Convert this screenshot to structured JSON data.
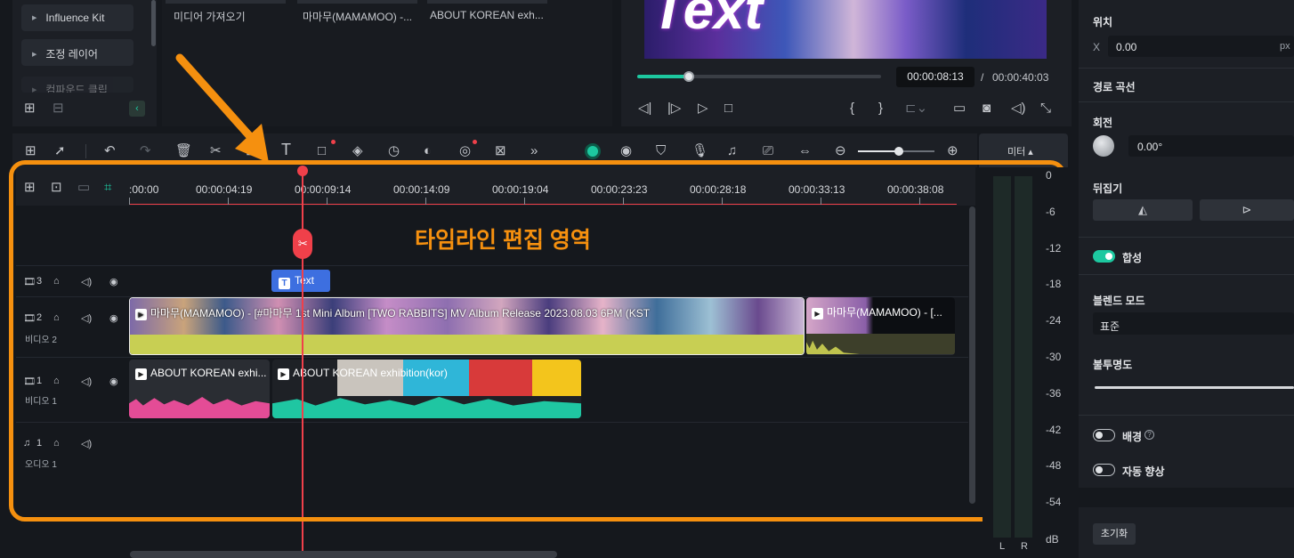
{
  "sidebar": {
    "items": [
      {
        "label": "Influence Kit"
      },
      {
        "label": "조정 레이어"
      },
      {
        "label": "컴파운드 클립"
      }
    ]
  },
  "media": {
    "items": [
      {
        "label": "미디어 가져오기"
      },
      {
        "label": "마마무(MAMAMOO) -..."
      },
      {
        "label": "ABOUT KOREAN exh..."
      }
    ]
  },
  "preview": {
    "overlay_text": "Text",
    "current_time": "00:00:08:13",
    "separator": "/",
    "total_time": "00:00:40:03",
    "progress": 0.21
  },
  "toolbar": {
    "meter_label": "미터 ▴"
  },
  "timeline": {
    "annotation": "타임라인 편집 영역",
    "playhead_fraction": 0.21,
    "ticks": [
      ":00:00",
      "00:00:04:19",
      "00:00:09:14",
      "00:00:14:09",
      "00:00:19:04",
      "00:00:23:23",
      "00:00:28:18",
      "00:00:33:13",
      "00:00:38:08"
    ],
    "tracks": [
      {
        "number": "3",
        "name": ""
      },
      {
        "number": "2",
        "name": "비디오 2"
      },
      {
        "number": "1",
        "name": "비디오 1"
      },
      {
        "number": "1",
        "name": "오디오 1"
      }
    ],
    "text_clip": "Text",
    "clips": {
      "v2a": "마마무(MAMAMOO) - [#마마무 1st Mini Album [TWO RABBITS] MV Album Release 2023.08.03 6PM (KST",
      "v2b": "마마무(MAMAMOO) - [...",
      "v1a": "ABOUT KOREAN exhi...",
      "v1b": "ABOUT KOREAN exhibition(kor)"
    }
  },
  "meter": {
    "labels": [
      "0",
      "-6",
      "-12",
      "-18",
      "-24",
      "-30",
      "-36",
      "-42",
      "-48",
      "-54"
    ],
    "unit": "dB",
    "left": "L",
    "right": "R"
  },
  "properties": {
    "position_label": "위치",
    "x_label": "X",
    "x_value": "0.00",
    "x_unit": "px",
    "path_curve": "경로 곡선",
    "rotation_label": "회전",
    "rotation_value": "0.00°",
    "flip_label": "뒤집기",
    "composite_label": "합성",
    "blend_mode_label": "블렌드 모드",
    "blend_mode_value": "표준",
    "opacity_label": "불투명도",
    "background_label": "배경",
    "auto_enhance_label": "자동 향상",
    "reset_label": "초기화"
  },
  "colors": {
    "accent": "#1dc8a0",
    "playhead": "#f0404a",
    "annotation": "#f5900f",
    "text_clip": "#3d6fe0"
  }
}
